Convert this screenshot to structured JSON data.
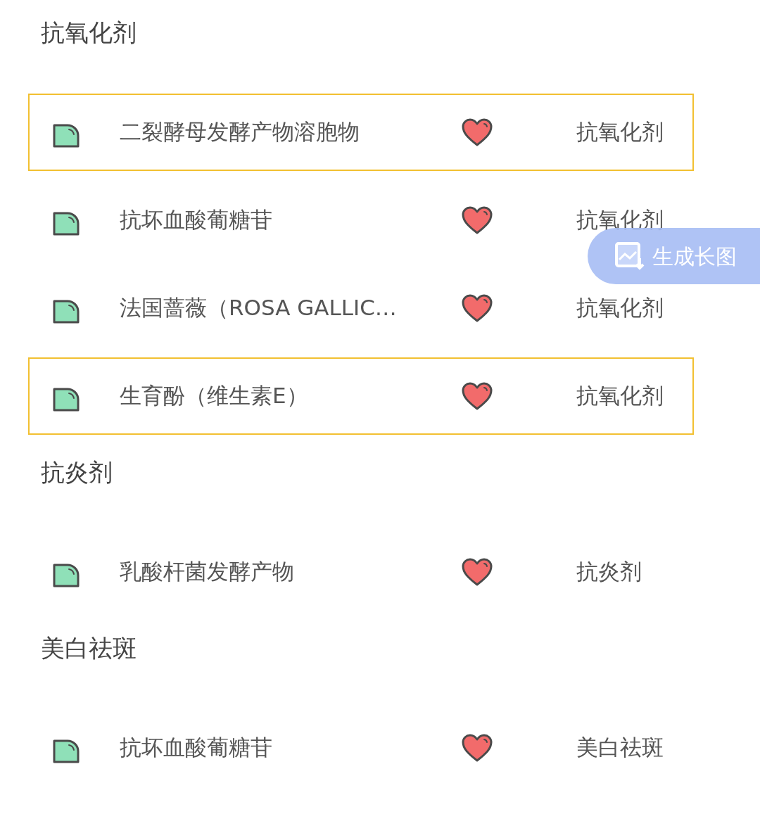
{
  "sections": [
    {
      "title": "抗氧化剂",
      "items": [
        {
          "name": "二裂酵母发酵产物溶胞物",
          "category": "抗氧化剂",
          "selected": true
        },
        {
          "name": "抗坏血酸葡糖苷",
          "category": "抗氧化剂",
          "selected": false
        },
        {
          "name": "法国蔷薇（ROSA GALLIC…",
          "category": "抗氧化剂",
          "selected": false
        },
        {
          "name": "生育酚（维生素E）",
          "category": "抗氧化剂",
          "selected": true
        }
      ]
    },
    {
      "title": "抗炎剂",
      "items": [
        {
          "name": "乳酸杆菌发酵产物",
          "category": "抗炎剂",
          "selected": false
        }
      ]
    },
    {
      "title": "美白祛斑",
      "items": [
        {
          "name": "抗坏血酸葡糖苷",
          "category": "美白祛斑",
          "selected": false
        }
      ]
    }
  ],
  "float_button": {
    "label": "生成长图"
  }
}
